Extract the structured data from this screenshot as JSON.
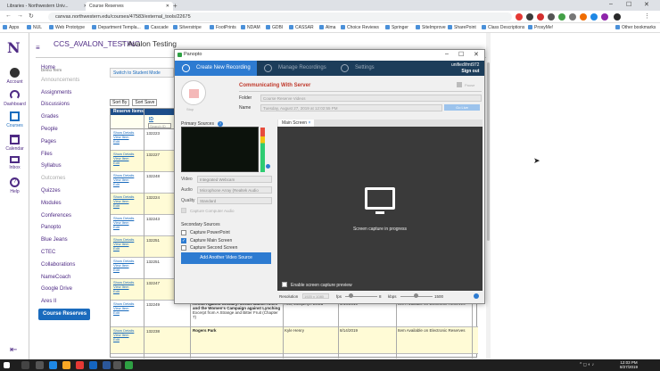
{
  "browser": {
    "tabs": [
      {
        "label": "Libraries - Northwestern Univ...",
        "active": false
      },
      {
        "label": "Course Reserves",
        "active": true
      }
    ],
    "url": "canvas.northwestern.edu/courses/47583/external_tools/22675",
    "bookmarks": [
      "Apps",
      "NUL",
      "Web Prototype",
      "Department Templa...",
      "Cascade",
      "Silverstripe",
      "FootPrints",
      "NDAM",
      "GDBI",
      "CASSAR",
      "Alma",
      "Choice Reviews",
      "Springer",
      "SiteImprove",
      "SharePoint",
      "Class Descriptions",
      "ProxyMe!",
      "Other bookmarks"
    ]
  },
  "global_nav": {
    "logo": "N",
    "items": [
      {
        "label": "Account",
        "icon": "avatar-icon"
      },
      {
        "label": "Dashboard",
        "icon": "dashboard-icon"
      },
      {
        "label": "Courses",
        "icon": "courses-icon"
      },
      {
        "label": "Calendar",
        "icon": "calendar-icon"
      },
      {
        "label": "Inbox",
        "icon": "inbox-icon"
      },
      {
        "label": "Help",
        "icon": "help-icon"
      }
    ]
  },
  "breadcrumb": {
    "course": "CCS_AVALON_TESTING",
    "sep": ">",
    "page": "Avalon Testing"
  },
  "course_nav": {
    "term": "Demo Term",
    "items": [
      {
        "label": "Home",
        "dim": false
      },
      {
        "label": "Announcements",
        "dim": true
      },
      {
        "label": "Assignments",
        "dim": false
      },
      {
        "label": "Discussions",
        "dim": false
      },
      {
        "label": "Grades",
        "dim": false
      },
      {
        "label": "People",
        "dim": false
      },
      {
        "label": "Pages",
        "dim": false
      },
      {
        "label": "Files",
        "dim": false
      },
      {
        "label": "Syllabus",
        "dim": false
      },
      {
        "label": "Outcomes",
        "dim": true
      },
      {
        "label": "Quizzes",
        "dim": false
      },
      {
        "label": "Modules",
        "dim": false
      },
      {
        "label": "Conferences",
        "dim": false
      },
      {
        "label": "Panopto",
        "dim": false
      },
      {
        "label": "Blue Jeans",
        "dim": false
      },
      {
        "label": "CTEC",
        "dim": false
      },
      {
        "label": "Collaborations",
        "dim": false
      },
      {
        "label": "NameCoach",
        "dim": false
      },
      {
        "label": "Google Drive",
        "dim": false
      },
      {
        "label": "Ares II",
        "dim": false
      },
      {
        "label": "Course Reserves",
        "dim": false,
        "active": true
      }
    ]
  },
  "reserves": {
    "student_btn": "Switch to Student Mode",
    "sort_by": "Sort By",
    "sort_save": "Sort Save",
    "header": "Reserve Items",
    "id_col": "ID",
    "id_search_placeholder": "Search ID",
    "link_show": "Show Details",
    "link_view": "View Item",
    "link_edit": "Edit",
    "rows": [
      {
        "id": "132223",
        "title": "",
        "author": "",
        "date": "",
        "status": "",
        "yellow": false
      },
      {
        "id": "132227",
        "title": "",
        "author": "",
        "date": "",
        "status": "",
        "yellow": true
      },
      {
        "id": "132248",
        "title": "",
        "author": "",
        "date": "",
        "status": "",
        "yellow": false
      },
      {
        "id": "132224",
        "title": "",
        "author": "",
        "date": "",
        "status": "",
        "yellow": true
      },
      {
        "id": "132243",
        "title": "",
        "author": "",
        "date": "",
        "status": "",
        "yellow": false
      },
      {
        "id": "132251",
        "title": "",
        "author": "",
        "date": "",
        "status": "",
        "yellow": true
      },
      {
        "id": "132251",
        "title": "",
        "author": "",
        "date": "",
        "status": "",
        "yellow": false
      },
      {
        "id": "132247",
        "title": "",
        "author": "",
        "date": "",
        "status": "",
        "yellow": true
      },
      {
        "id": "132249",
        "title": "Revolt Against Chivalry: Jessie Daniel Ames and the Women's Campaign against Lynching",
        "subtitle": "Excerpt from A Strange and Bitter Fruit (Chapter 7)",
        "author": "Hall, Jacquelyn Dowd",
        "date": "8/14/2019",
        "status": "Item Available on Electronic Reserves",
        "yellow": false
      },
      {
        "id": "132238",
        "title": "Rogers Park",
        "subtitle": "",
        "author": "Kyle Henry",
        "date": "8/14/2019",
        "status": "Item Available on Electronic Reserves",
        "yellow": true
      }
    ]
  },
  "panopto": {
    "window_title": "Panopto",
    "tabs": [
      "Create New Recording",
      "Manage Recordings",
      "Settings"
    ],
    "user": "unified\\fmt972",
    "sign_out": "Sign out",
    "stop": "Stop",
    "status": "Communicating With Server",
    "pause": "Pause",
    "folder_label": "Folder",
    "folder_value": "Course Reserve Videos",
    "name_label": "Name",
    "name_value": "Tuesday, August 27, 2019 at 12:02:55 PM",
    "webcast_btn": "Go Live",
    "primary_sources": "Primary Sources",
    "video_label": "Video",
    "video_value": "Integrated Webcam",
    "audio_label": "Audio",
    "audio_value": "Microphone Array (Realtek Audio",
    "quality_label": "Quality",
    "quality_value": "Standard",
    "capture_computer_audio": "Capture Computer Audio",
    "secondary_sources": "Secondary Sources",
    "sec_items": [
      {
        "label": "Capture PowerPoint",
        "checked": false
      },
      {
        "label": "Capture Main Screen",
        "checked": true
      },
      {
        "label": "Capture Second Screen",
        "checked": false
      }
    ],
    "add_video": "Add Another Video Source",
    "main_screen_tab": "Main Screen",
    "capture_status": "Screen capture in progress",
    "enable_preview": "Enable screen capture preview",
    "resolution_label": "Resolution",
    "resolution_value": "1920 x 1080",
    "fps_label": "fps",
    "fps_value": "8",
    "kbps_label": "kbps",
    "kbps_value": "1500"
  },
  "taskbar": {
    "time": "12:03 PM",
    "date": "8/27/2019"
  }
}
